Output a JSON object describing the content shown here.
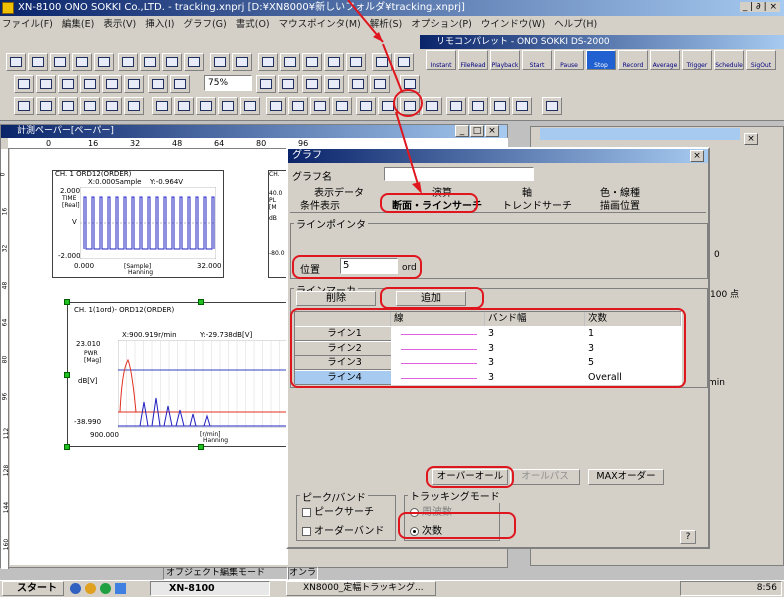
{
  "app": {
    "title": "XN-8100 ONO SOKKI Co.,LTD. - tracking.xnprj [D:¥XN8000¥新しいフォルダ¥tracking.xnprj]",
    "title_controls": "_ | ∂ | ×"
  },
  "menu": [
    "ファイル(F)",
    "編集(E)",
    "表示(V)",
    "挿入(I)",
    "グラフ(G)",
    "書式(O)",
    "マウスポインタ(M)",
    "解析(S)",
    "オプション(P)",
    "ウインドウ(W)",
    "ヘルプ(H)"
  ],
  "toolbar": {
    "zoom_value": "75%"
  },
  "remote": {
    "title": "リモコンパレット - ONO SOKKI DS-2000",
    "buttons": [
      "Instant",
      "FileRead",
      "Playback",
      "Start",
      "Pause",
      "Stop",
      "Record",
      "Average",
      "Trigger",
      "Schedule",
      "SigOut"
    ]
  },
  "graph_window": {
    "title": "計測ペーパー[ペーパー]",
    "ruler": [
      "0",
      "16",
      "32",
      "48",
      "64",
      "80",
      "96"
    ],
    "vruler": [
      "0",
      "16",
      "32",
      "48",
      "64",
      "80",
      "96",
      "112",
      "128",
      "144",
      "160"
    ]
  },
  "chart1": {
    "title": "CH. 1 ORD12(ORDER)",
    "cursor_x": "X:0.000Sample",
    "cursor_y": "Y:-0.964V",
    "y_top": "2.000",
    "y_bottom": "-2.000",
    "y_unit": "TIME\n[Real]",
    "y_label": "V",
    "x_left": "0.000",
    "x_right": "32.000",
    "x_label": "[Sample]",
    "window": "Hanning"
  },
  "chart2": {
    "title": "CH. 1(1ord)- ORD12(ORDER)",
    "cursor_x": "X:900.919r/min",
    "cursor_y": "Y:-29.738dB[V]",
    "y_top": "23.010",
    "y_unit": "PWR\n[Mag]",
    "y_label": "dB[V]",
    "y_bottom": "-38.990",
    "x_left": "900.000",
    "x_label": "[r/min]",
    "window": "Hanning"
  },
  "partial_ch": {
    "label": "CH.",
    "top": "40.0",
    "mid": "PL",
    "unit": "[M",
    "db": "dB",
    "bot": "-80.0"
  },
  "dialog": {
    "title": "グラフ",
    "name_label": "グラフ名",
    "tabs_row1": [
      "表示データ",
      "演算",
      "軸",
      "色・線種"
    ],
    "tabs_row2": [
      "条件表示",
      "断面・ラインサーチ",
      "トレンドサーチ",
      "描画位置"
    ],
    "line_pointer": {
      "legend": "ラインポインタ",
      "position_label": "位置",
      "position_value": "5",
      "unit": "ord"
    },
    "line_marker": {
      "legend": "ラインマーカ",
      "delete_button": "削除",
      "add_button": "追加",
      "headers": [
        "",
        "線",
        "バンド幅",
        "次数"
      ],
      "rows": [
        [
          "ライン1",
          "3",
          "1"
        ],
        [
          "ライン2",
          "3",
          "3"
        ],
        [
          "ライン3",
          "3",
          "5"
        ],
        [
          "ライン4",
          "3",
          "Overall"
        ]
      ]
    },
    "overall_button": "オーバーオール",
    "all_pass_button": "オールパス",
    "max_order_button": "MAXオーダー",
    "peak_band": {
      "legend": "ピーク/バンド",
      "peak_search": "ピークサーチ",
      "order_band": "オーダーバンド"
    },
    "tracking_mode": {
      "legend": "トラッキングモード",
      "frequency": "周波数",
      "order": "次数"
    },
    "help_button": "?"
  },
  "side_panel": {
    "val1": "0",
    "val2": "100 点",
    "val3": "min"
  },
  "status": {
    "mode": "オブジェクト編集モード",
    "online": "オンライン"
  },
  "taskbar": {
    "start": "スタート",
    "task1": "XN-8100",
    "task2": "XN8000_定幅トラッキング...",
    "clock": "8:56"
  },
  "colors": {
    "accent": "#e0161e",
    "titlebar": "#0a246a",
    "selected_row": "#a6caf0"
  }
}
